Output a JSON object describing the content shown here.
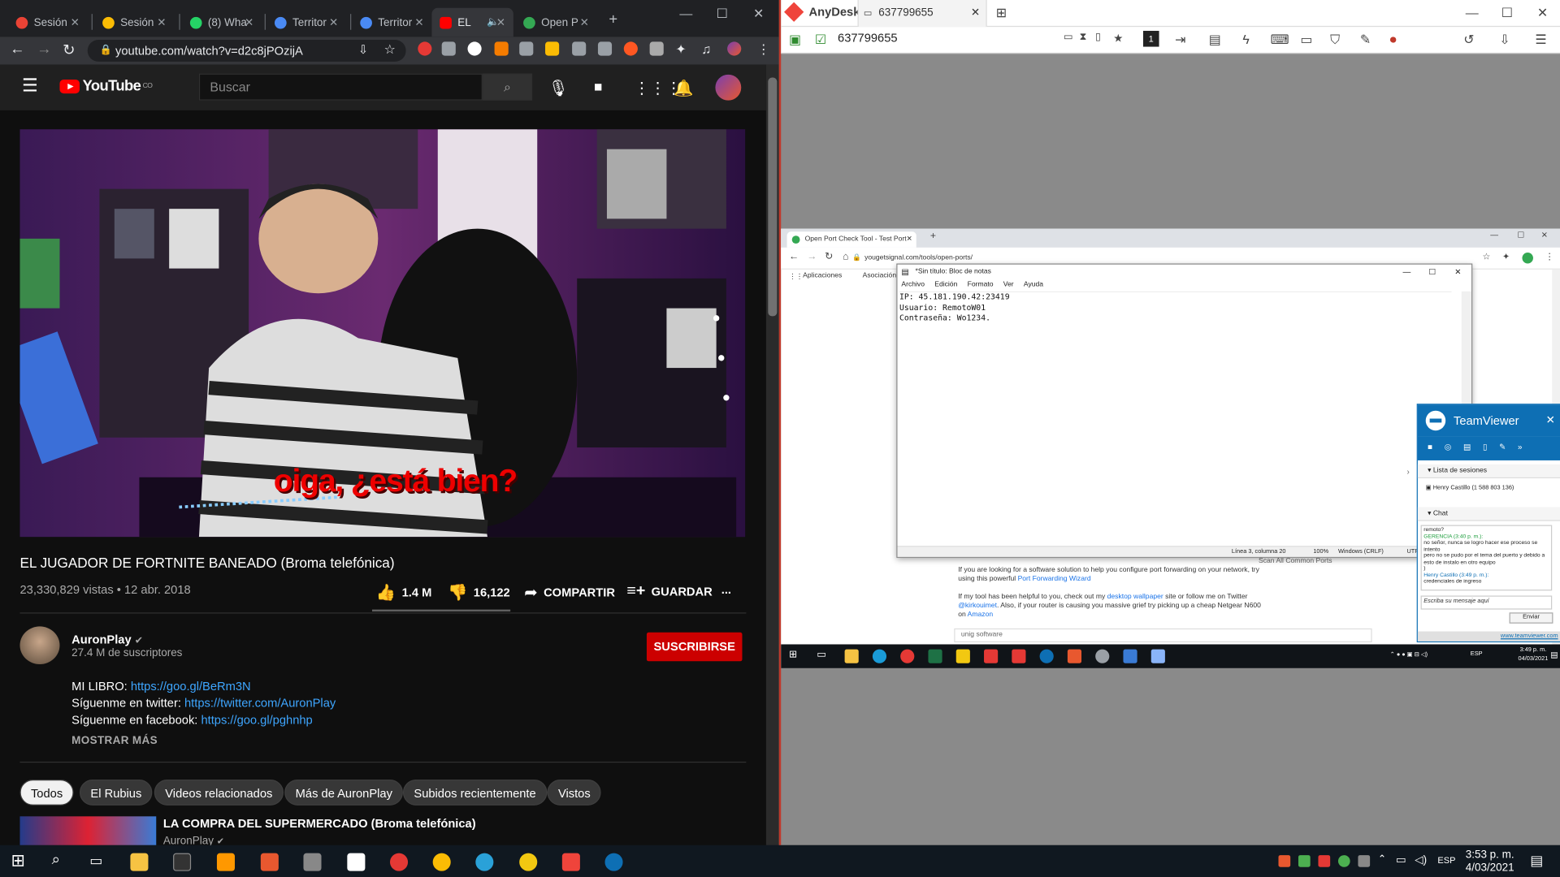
{
  "chrome": {
    "tabs": [
      {
        "label": "Sesión",
        "color": "#ea4335"
      },
      {
        "label": "Sesión",
        "color": "#fbbc04"
      },
      {
        "label": "(8) Wha",
        "color": "#25d366"
      },
      {
        "label": "Territor",
        "color": "#4a8af4"
      },
      {
        "label": "Territor",
        "color": "#4a8af4"
      },
      {
        "label": "EL",
        "color": "#ff0000"
      },
      {
        "label": "Open P",
        "color": "#34a853"
      }
    ],
    "url": "youtube.com/watch?v=d2c8jPOzijA"
  },
  "youtube": {
    "logo_text": "YouTube",
    "country": "CO",
    "search_placeholder": "Buscar",
    "video_caption": "oiga, ¿está bien?",
    "title": "EL JUGADOR DE FORTNITE BANEADO (Broma telefónica)",
    "views_date": "23,330,829 vistas • 12 abr. 2018",
    "likes": "1.4 M",
    "dislikes": "16,122",
    "share": "COMPARTIR",
    "save": "GUARDAR",
    "more": "...",
    "channel": "AuronPlay",
    "subscribers": "27.4 M de suscriptores",
    "subscribe": "SUSCRIBIRSE",
    "desc": [
      {
        "label": "MI LIBRO: ",
        "link": "https://goo.gl/BeRm3N"
      },
      {
        "label": "Síguenme en twitter: ",
        "link": "https://twitter.com/AuronPlay"
      },
      {
        "label": "Síguenme en facebook: ",
        "link": "https://goo.gl/pghnhp"
      }
    ],
    "show_more": "MOSTRAR MÁS",
    "chips": [
      "Todos",
      "El Rubius",
      "Videos relacionados",
      "Más de AuronPlay",
      "Subidos recientemente",
      "Vistos"
    ],
    "rec_title": "LA COMPRA DEL SUPERMERCADO (Broma telefónica)",
    "rec_channel": "AuronPlay"
  },
  "anydesk": {
    "app": "AnyDesk",
    "tab": "637799655",
    "address": "637799655",
    "monitor": "1"
  },
  "remote": {
    "tab": "Open Port Check Tool - Test Port",
    "url": "yougetsignal.com/tools/open-ports/",
    "bookmarks": [
      "Aplicaciones",
      "Asociación"
    ],
    "page_text_1": "If you are looking for a software solution to help you configure port forwarding on your network, try using this powerful ",
    "page_link_1": "Port Forwarding Wizard",
    "page_text_2": "If my tool has been helpful to you, check out my ",
    "page_link_2": "desktop wallpaper",
    "page_text_3": " site or follow me on Twitter ",
    "page_link_3": "@kirkouimet",
    "page_text_4": ". Also, if your router is causing you massive grief try picking up a cheap Netgear N600 on ",
    "page_link_4": "Amazon",
    "page_scan": "Scan All Common Ports",
    "page_footer": "unig software",
    "notepad": {
      "title": "*Sin título: Bloc de notas",
      "menu": [
        "Archivo",
        "Edición",
        "Formato",
        "Ver",
        "Ayuda"
      ],
      "line1": "IP: 45.181.190.42:23419",
      "line2": "Usuario: RemotoW01",
      "line3": "Contraseña: Wo1234.",
      "status_pos": "Línea 3, columna 20",
      "status_zoom": "100%",
      "status_eol": "Windows (CRLF)",
      "status_enc": "UTF"
    },
    "teamviewer": {
      "title": "TeamViewer",
      "sessions_header": "Lista de sesiones",
      "session": "Henry Castillo (1 588 803 136)",
      "chat_header": "Chat",
      "chat_lines": [
        {
          "cls": "",
          "text": "remoto?"
        },
        {
          "cls": "g",
          "text": "GERENCIA (3:40 p. m.):"
        },
        {
          "cls": "",
          "text": "no señor, nunca se logro hacer ese proceso se intento"
        },
        {
          "cls": "",
          "text": "pero no se pudo por el tema del puerto y debido a esto de instalo en otro equipo"
        },
        {
          "cls": "",
          "text": ")"
        },
        {
          "cls": "b",
          "text": "Henry Castillo (3:49 p. m.):"
        },
        {
          "cls": "",
          "text": "credenciales de ingreso"
        }
      ],
      "input_placeholder": "Escriba su mensaje aquí",
      "send": "Enviar",
      "footer": "www.teamviewer.com"
    },
    "lang": "ESP",
    "time": "3:49 p. m.",
    "date": "04/03/2021"
  },
  "taskbar": {
    "lang": "ESP",
    "time": "3:53 p. m.",
    "date": "4/03/2021"
  }
}
